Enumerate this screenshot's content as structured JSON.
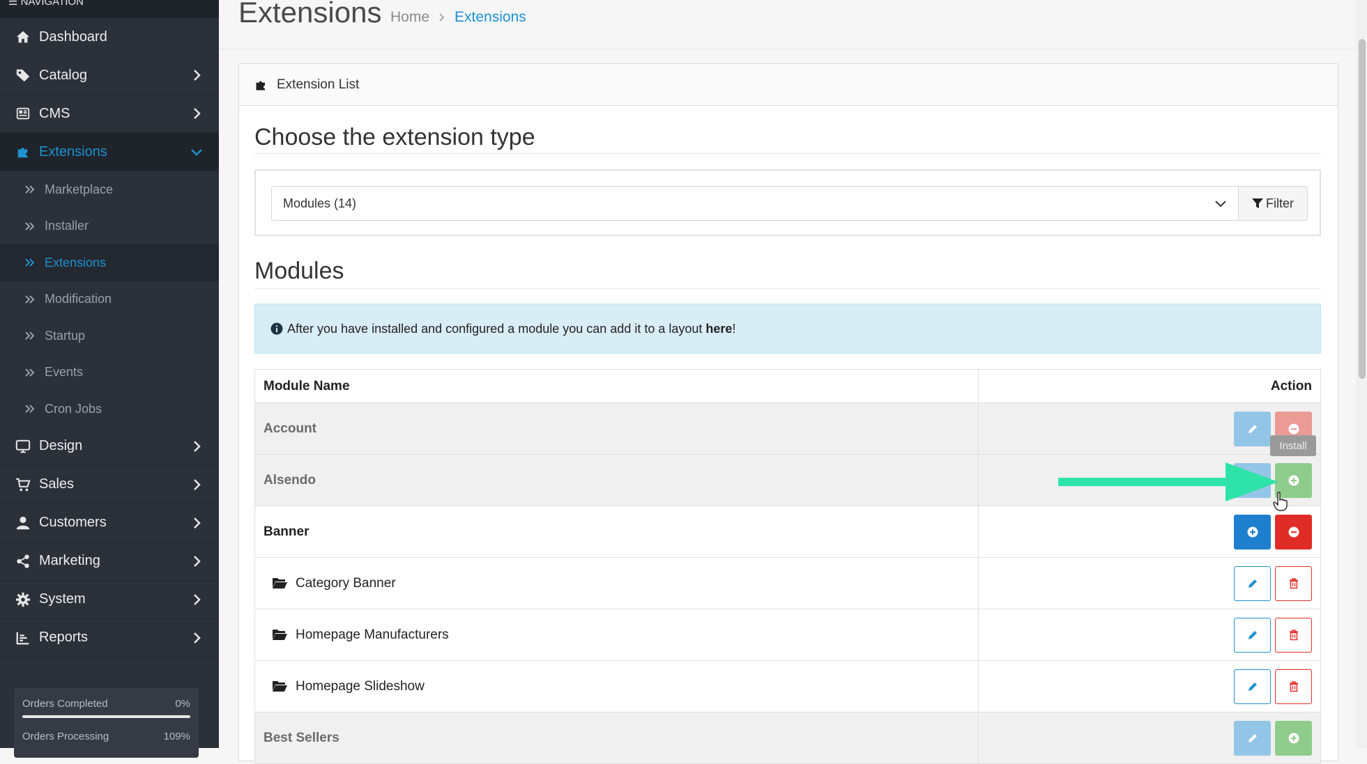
{
  "nav": {
    "heading": "☰ NAVIGATION",
    "items": [
      {
        "label": "Dashboard",
        "icon": "home-icon"
      },
      {
        "label": "Catalog",
        "icon": "tag-icon"
      },
      {
        "label": "CMS",
        "icon": "newspaper-icon"
      },
      {
        "label": "Extensions",
        "icon": "puzzle-icon"
      },
      {
        "label": "Design",
        "icon": "monitor-icon"
      },
      {
        "label": "Sales",
        "icon": "cart-icon"
      },
      {
        "label": "Customers",
        "icon": "user-icon"
      },
      {
        "label": "Marketing",
        "icon": "share-icon"
      },
      {
        "label": "System",
        "icon": "gear-icon"
      },
      {
        "label": "Reports",
        "icon": "chart-icon"
      }
    ],
    "sub_items": [
      "Marketplace",
      "Installer",
      "Extensions",
      "Modification",
      "Startup",
      "Events",
      "Cron Jobs"
    ],
    "progress": [
      {
        "label": "Orders Completed",
        "value": "0%",
        "fraction": 0
      },
      {
        "label": "Orders Processing",
        "value": "109%",
        "fraction": 1
      }
    ]
  },
  "header": {
    "title": "Extensions",
    "breadcrumb": [
      "Home",
      "Extensions"
    ]
  },
  "panel": {
    "heading": "Extension List",
    "choose_title": "Choose the extension type",
    "select_value": "Modules (14)",
    "filter_label": "Filter",
    "modules_title": "Modules",
    "alert_text": "After you have installed and configured a module you can add it to a layout ",
    "alert_link": "here",
    "alert_end": "!",
    "table": {
      "col_name": "Module Name",
      "col_action": "Action",
      "rows": [
        {
          "name": "Account"
        },
        {
          "name": "Alsendo"
        },
        {
          "name": "Banner"
        },
        {
          "name": "Category Banner"
        },
        {
          "name": "Homepage Manufacturers"
        },
        {
          "name": "Homepage Slideshow"
        },
        {
          "name": "Best Sellers"
        }
      ]
    },
    "tooltip": "Install"
  },
  "colors": {
    "accent": "#1e91cf",
    "danger": "#e02c27",
    "success": "#8fcc8c",
    "sidebar": "#2b3039",
    "annotation": "#2ee3a8"
  }
}
